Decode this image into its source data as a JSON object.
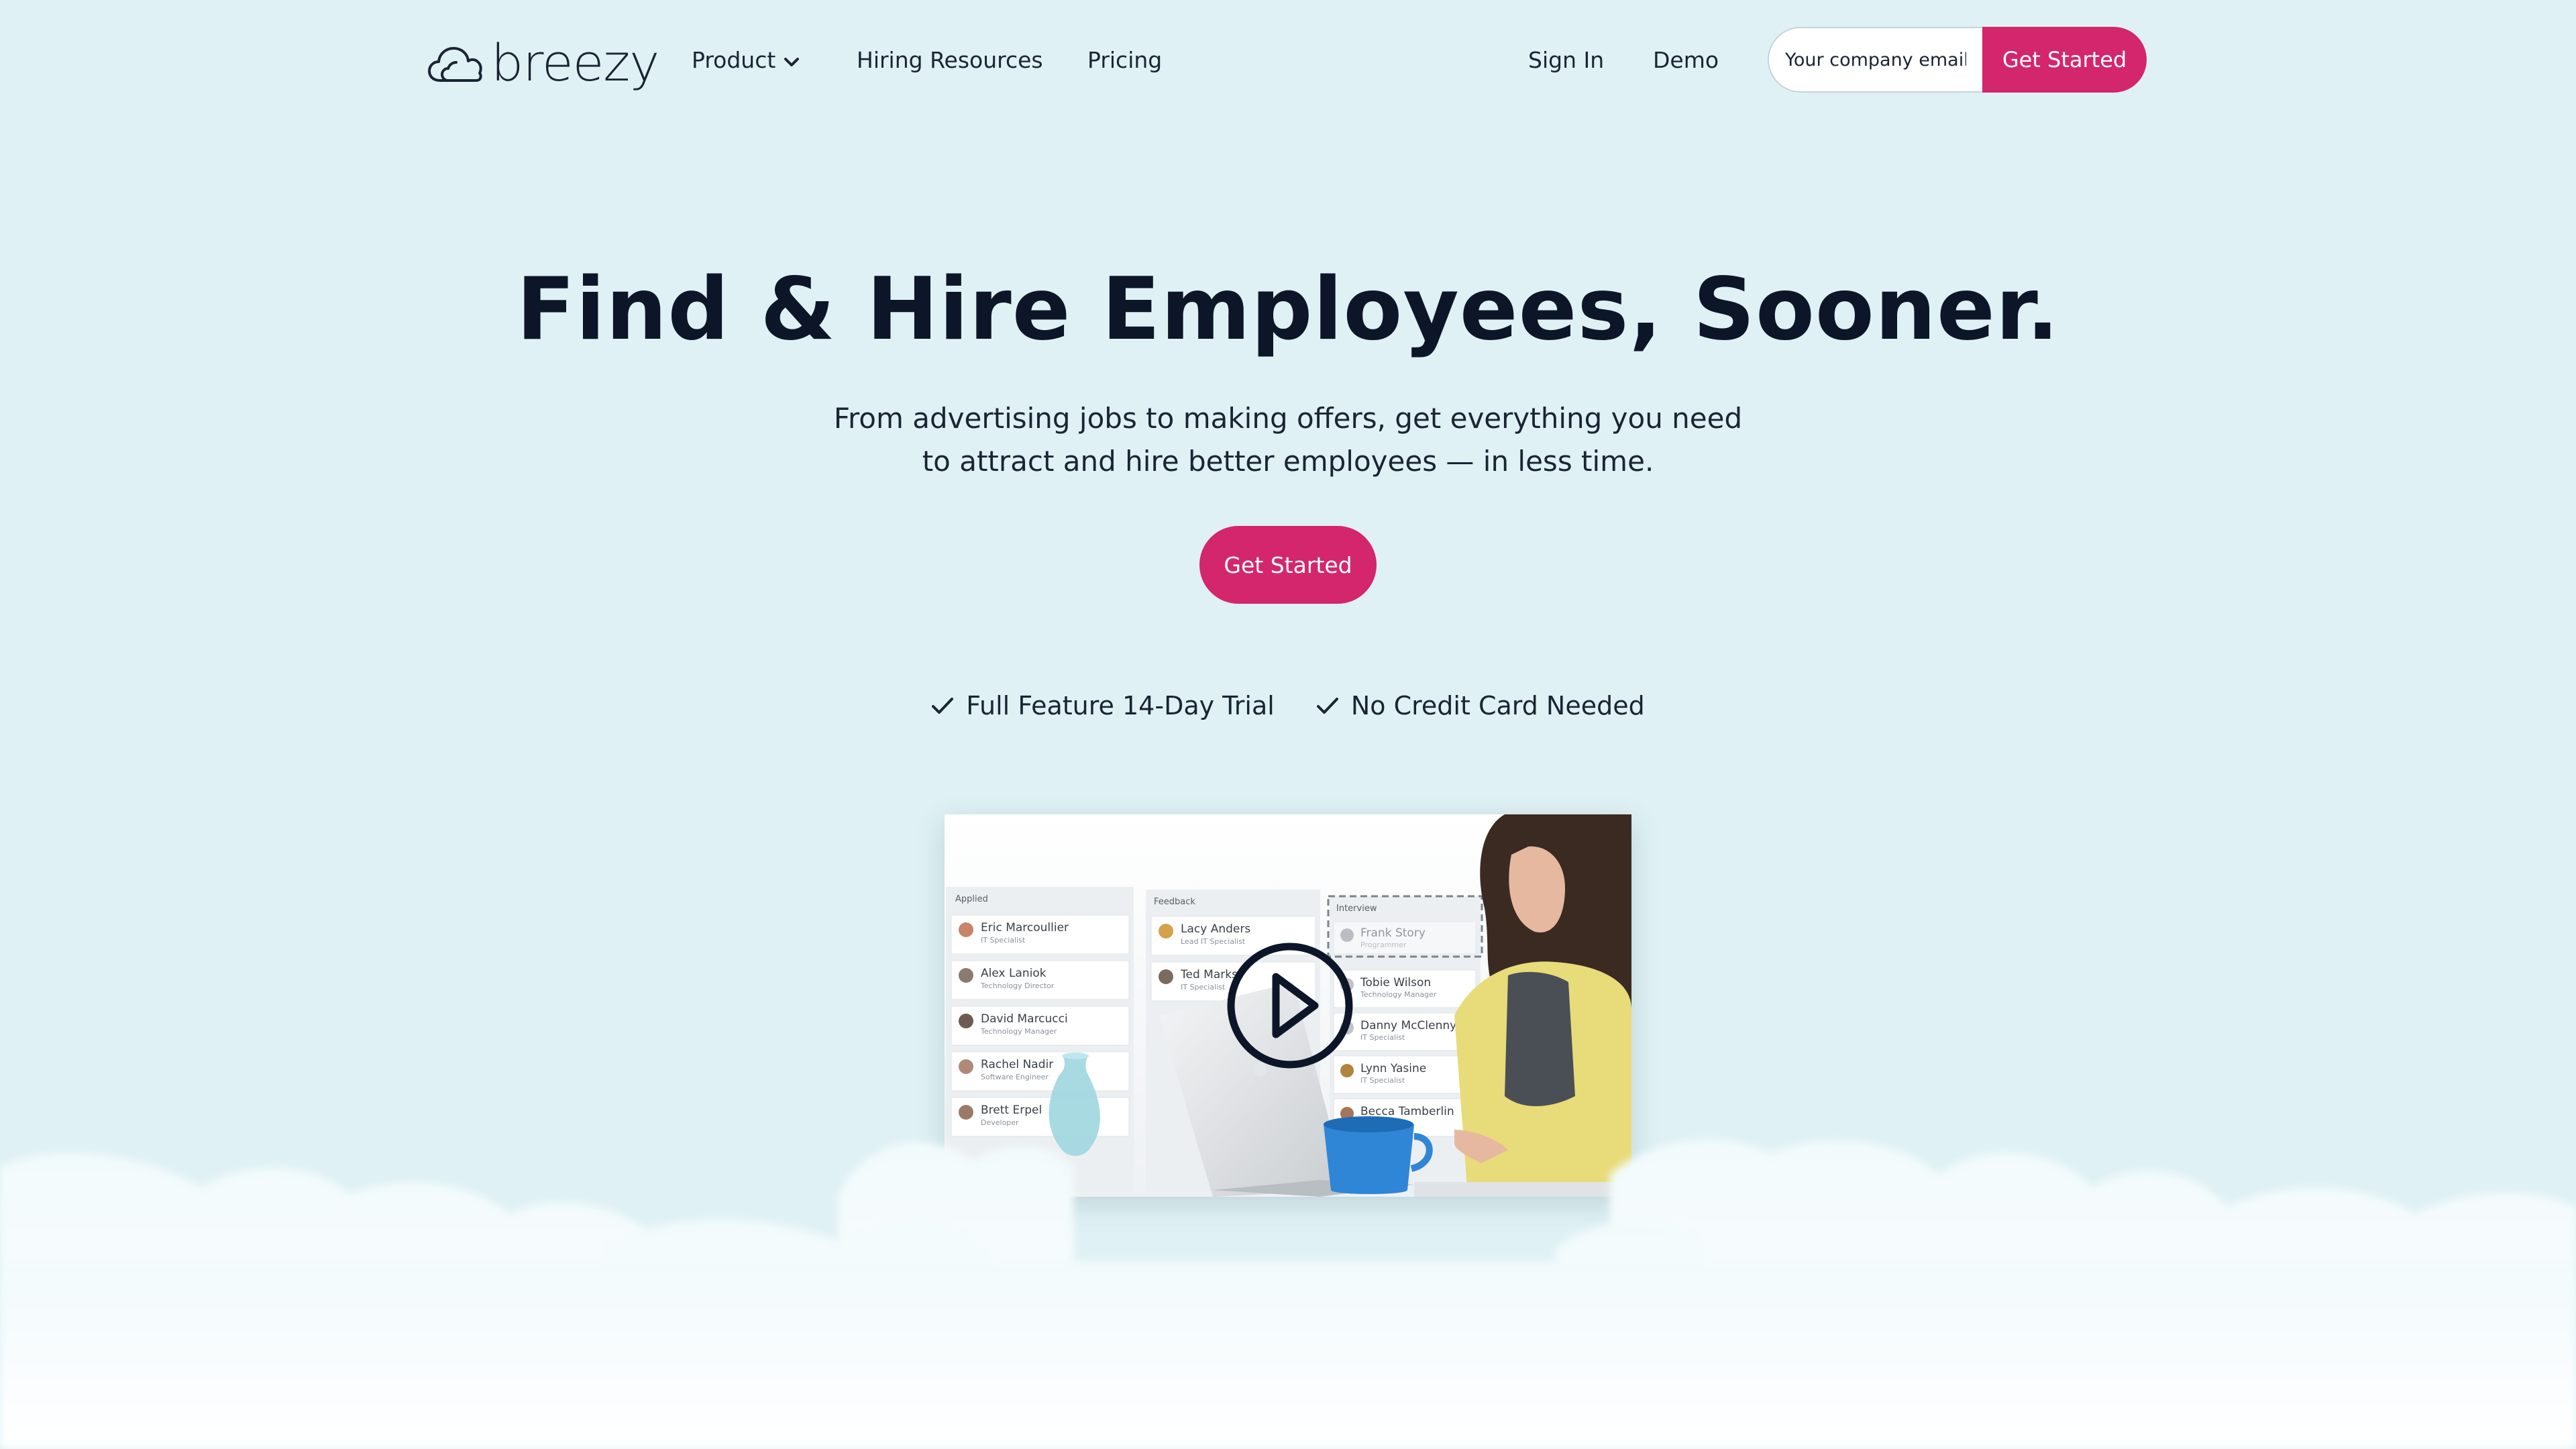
{
  "brand": {
    "name": "breezy",
    "logo_icon": "cloud-icon",
    "accent_color": "#d3266d",
    "background_color": "#dff1f4",
    "text_color": "#0d1628"
  },
  "nav": {
    "product": "Product",
    "product_icon": "chevron-down-icon",
    "hiring_resources": "Hiring Resources",
    "pricing": "Pricing",
    "sign_in": "Sign In",
    "demo": "Demo"
  },
  "signup": {
    "email_placeholder": "Your company email",
    "email_value": "",
    "button": "Get Started"
  },
  "hero": {
    "title": "Find & Hire Employees, Sooner.",
    "subtitle_line1": "From advertising jobs to making offers, get everything you need",
    "subtitle_line2": "to attract and hire better employees — in less time.",
    "cta": "Get Started",
    "perks": [
      {
        "icon": "check-icon",
        "label": "Full Feature 14-Day Trial"
      },
      {
        "icon": "check-icon",
        "label": "No Credit Card Needed"
      }
    ]
  },
  "video": {
    "play_icon": "play-icon",
    "columns": [
      {
        "title": "Applied",
        "candidates": [
          {
            "name": "Eric Marcoullier",
            "role": "IT Specialist"
          },
          {
            "name": "Alex Laniok",
            "role": "Technology Director"
          },
          {
            "name": "David Marcucci",
            "role": "Technology Manager"
          },
          {
            "name": "Rachel Nadir",
            "role": "Software Engineer"
          },
          {
            "name": "Brett Erpel",
            "role": "Developer"
          }
        ]
      },
      {
        "title": "Feedback",
        "candidates": [
          {
            "name": "Lacy Anders",
            "role": "Lead IT Specialist"
          },
          {
            "name": "Ted Marks",
            "role": "IT Specialist"
          }
        ]
      },
      {
        "title": "Interview",
        "candidates": [
          {
            "name": "Frank Story",
            "role": "Programmer"
          },
          {
            "name": "Tobie Wilson",
            "role": "Technology Manager"
          },
          {
            "name": "Danny McClenny",
            "role": "IT Specialist"
          },
          {
            "name": "Lynn Yasine",
            "role": "IT Specialist"
          },
          {
            "name": "Becca Tamberlin",
            "role": "IT Specialist"
          }
        ]
      }
    ]
  }
}
